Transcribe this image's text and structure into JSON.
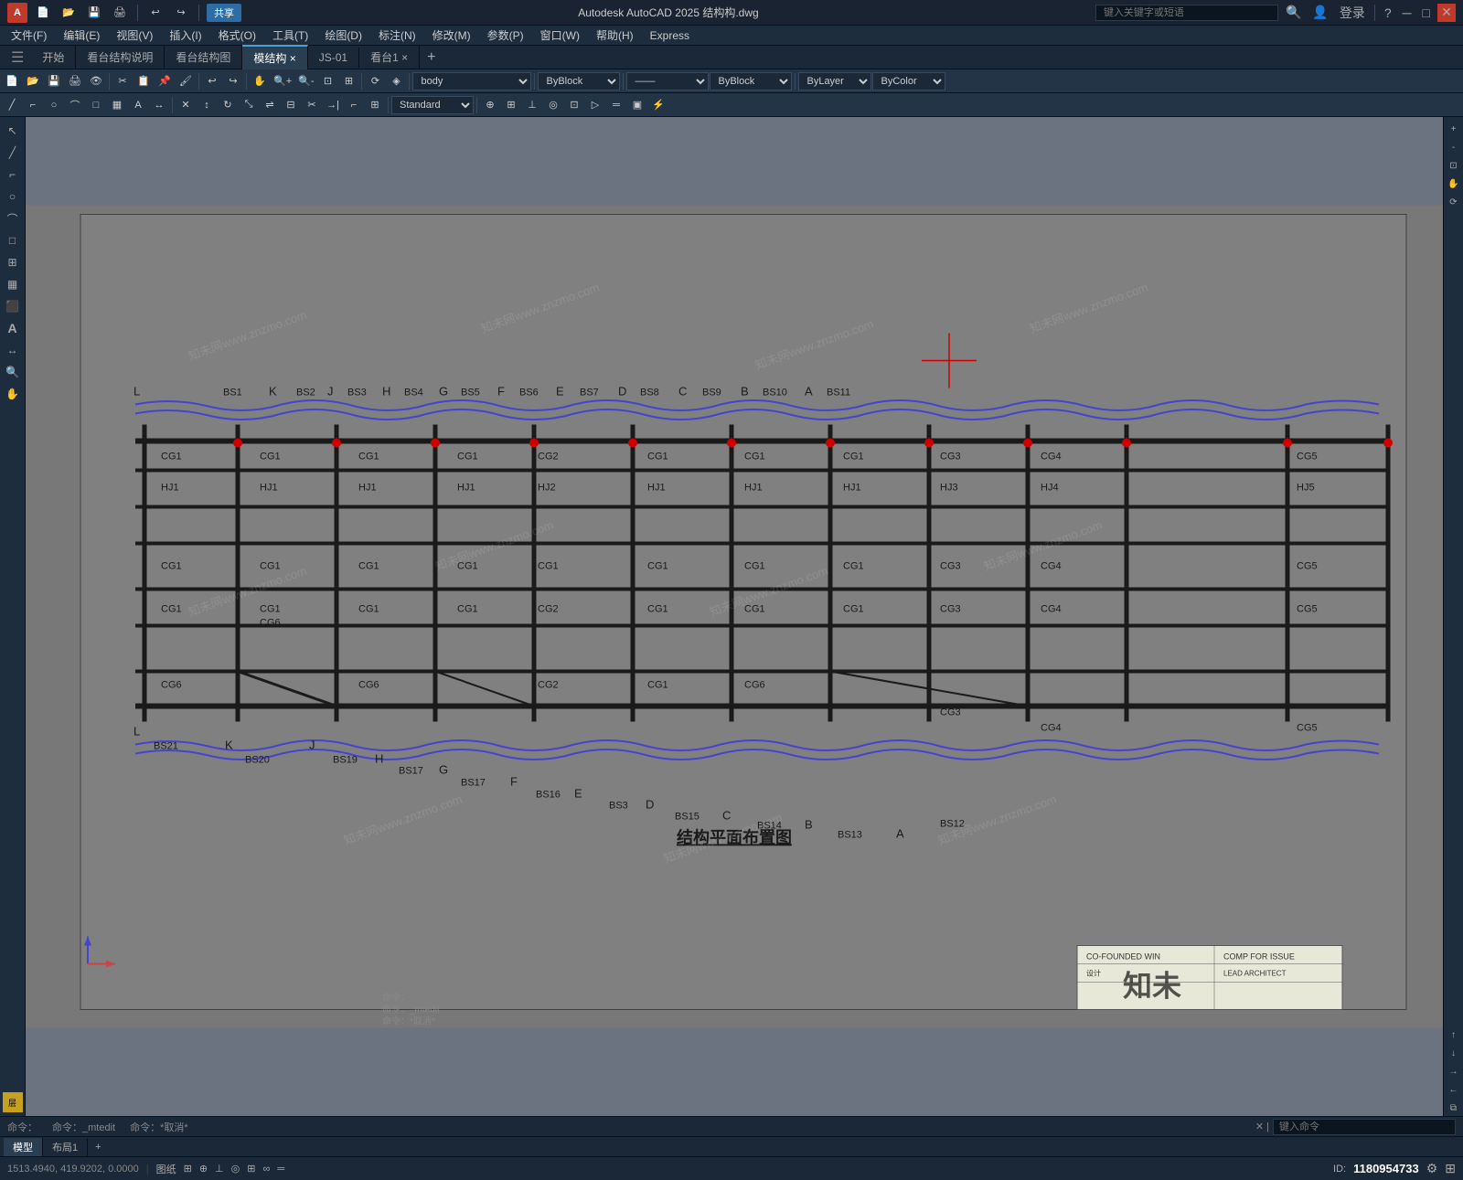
{
  "app": {
    "title": "Autodesk AutoCAD 2025  结构构.dwg",
    "logo": "A",
    "share_label": "共享"
  },
  "search": {
    "placeholder": "键入关键字或短语"
  },
  "menu": {
    "items": [
      "文件(F)",
      "编辑(E)",
      "视图(V)",
      "插入(I)",
      "格式(O)",
      "工具(T)",
      "绘图(D)",
      "标注(N)",
      "修改(M)",
      "参数(P)",
      "窗口(W)",
      "帮助(H)",
      "Express"
    ]
  },
  "tabs": {
    "items": [
      "开始",
      "看台结构说明",
      "看台结构图",
      "模结构 ×",
      "JS-01",
      "看台1 ×"
    ],
    "active_index": 3
  },
  "toolbar": {
    "layer_input": "body",
    "color1": "ByBlock",
    "color2": "ByBlock",
    "color3": "ByLayer",
    "color4": "ByColor",
    "standard": "Standard"
  },
  "drawing": {
    "title": "结构平面布置图",
    "watermarks": [
      "知未网www.znzmo.com",
      "知未网www.znzmo.com",
      "知未网www.znzmo.com",
      "知未网www.znzmo.com",
      "知未网www.znzmo.com",
      "知未网www.znzmo.com"
    ],
    "crosshair_visible": true,
    "grid_labels_top": [
      "L",
      "BS1",
      "K",
      "BS2",
      "J",
      "BS3",
      "H",
      "BS4",
      "G",
      "BS5",
      "F",
      "BS6",
      "E",
      "BS7",
      "D",
      "BS8",
      "C",
      "BS9",
      "B",
      "BS10",
      "A",
      "BS11"
    ],
    "grid_labels_bottom": [
      "L",
      "BS21",
      "K",
      "BS20",
      "J",
      "BS19",
      "H",
      "BS17",
      "G",
      "BS17",
      "F",
      "BS16",
      "E",
      "BS3",
      "D",
      "BS15",
      "C",
      "BS14",
      "B",
      "BS13",
      "A",
      "BS12"
    ],
    "beam_labels": [
      "CG1",
      "CG2",
      "CG3",
      "CG4",
      "CG5",
      "CG6"
    ],
    "hj_labels": [
      "HJ1",
      "HJ2",
      "HJ3",
      "HJ4",
      "HJ5"
    ],
    "detected_text": "CGI"
  },
  "status_bar": {
    "model_tab": "模型",
    "layout_tab1": "布局1",
    "coordinates": "1513.4940, 419.9202, 0.0000",
    "paper_mode": "图纸",
    "id_label": "ID:",
    "id_value": "1180954733"
  },
  "command_bar": {
    "labels": [
      "命令：",
      "命令：_mtedit",
      "命令：*取消*"
    ],
    "input_placeholder": "键入命令"
  },
  "znzmo_logo": "知未"
}
